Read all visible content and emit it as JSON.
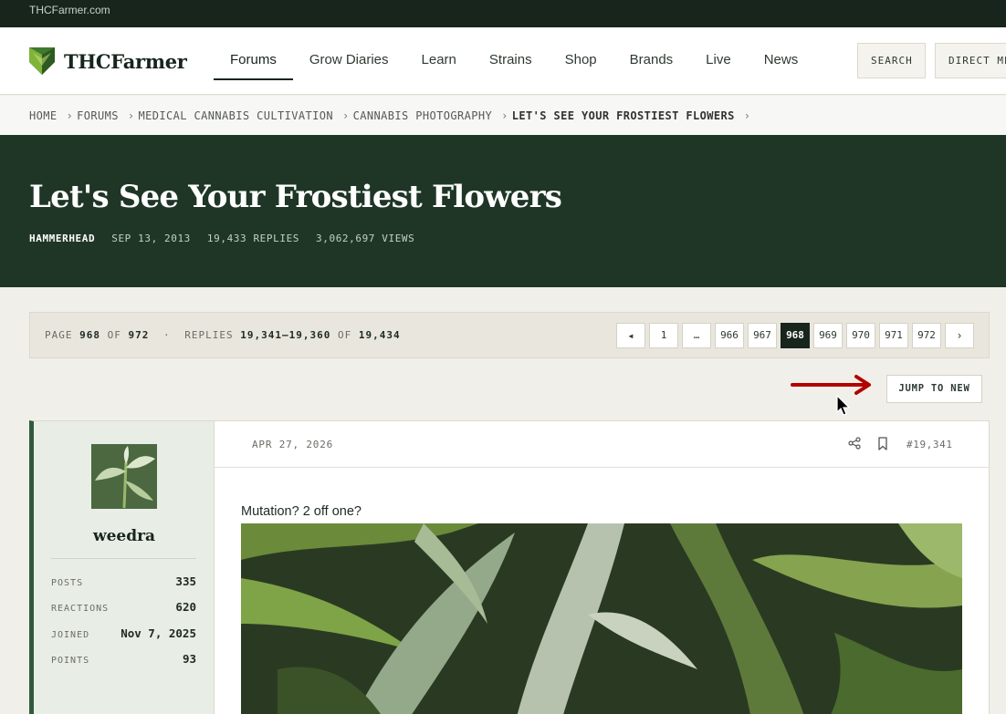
{
  "topbar": {
    "site": "THCFarmer.com"
  },
  "header": {
    "brand": "THCFarmer",
    "nav": [
      "Forums",
      "Grow Diaries",
      "Learn",
      "Strains",
      "Shop",
      "Brands",
      "Live",
      "News"
    ],
    "active_nav": "Forums",
    "search_label": "SEARCH",
    "dm_label": "DIRECT MESSAGES"
  },
  "breadcrumb": [
    "HOME",
    "FORUMS",
    "MEDICAL CANNABIS CULTIVATION",
    "CANNABIS PHOTOGRAPHY",
    "LET'S SEE YOUR FROSTIEST FLOWERS"
  ],
  "thread": {
    "title": "Let's See Your Frostiest Flowers",
    "author": "HAMMERHEAD",
    "date": "SEP 13, 2013",
    "replies": "19,433 REPLIES",
    "views": "3,062,697 VIEWS"
  },
  "pagination": {
    "page_word": "PAGE",
    "current": "968",
    "of_word": "OF",
    "total": "972",
    "replies_word": "REPLIES",
    "range": "19,341–19,360",
    "total_replies": "19,434",
    "pages": [
      "1",
      "…",
      "966",
      "967",
      "968",
      "969",
      "970",
      "971",
      "972"
    ],
    "prev_icon": "caret-left-icon",
    "next_icon": "chevron-right-icon"
  },
  "jump_label": "JUMP TO NEW",
  "colors": {
    "annotation_arrow": "#b30000",
    "hero_bg": "#1f3627",
    "accent": "#2f5a3c"
  },
  "post": {
    "user": "weedra",
    "stats": [
      {
        "k": "POSTS",
        "v": "335"
      },
      {
        "k": "REACTIONS",
        "v": "620"
      },
      {
        "k": "JOINED",
        "v": "Nov 7, 2025"
      },
      {
        "k": "POINTS",
        "v": "93"
      }
    ],
    "date": "APR 27, 2026",
    "number": "#19,341",
    "text": "Mutation? 2 off one?"
  }
}
